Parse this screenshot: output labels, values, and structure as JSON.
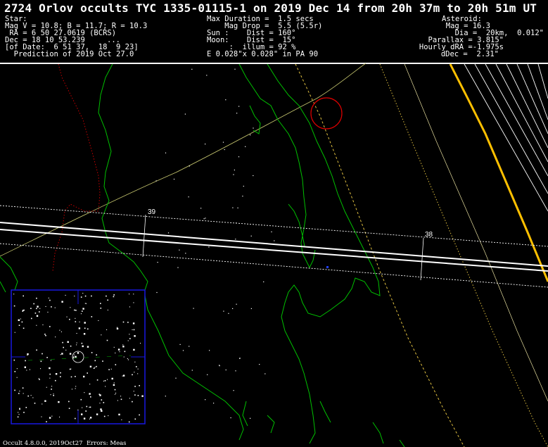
{
  "title": "2724 Orlov occults TYC 1335-01115-1 on 2019 Dec 14 from 20h 37m to 20h 51m UT",
  "star": {
    "heading": "Star:",
    "mags": "Mag V = 10.8; B = 11.7; R = 10.3",
    "ra": " RA = 6 50 27.0619 (BCRS)",
    "dec": "Dec = 18 10 53.239",
    "dec_extra": "...",
    "of_date": "[of Date:  6 51 37,  18  9 23]",
    "prediction": "  Prediction of 2019 Oct 27.0"
  },
  "event": {
    "max_duration": "Max Duration =  1.5 secs",
    "mag_drop": "    Mag Drop =  5.5 (5.5r)",
    "sun": "Sun :    Dist = 160°",
    "moon": "Moon:    Dist =  15°",
    "illum": "     :  illum = 92 %",
    "ellipse": "E 0.028\"x 0.028\" in PA 90"
  },
  "asteroid": {
    "heading": "Asteroid:",
    "mag": "Mag = 16.3",
    "dia": "Dia =  20km,  0.012\"",
    "parallax": "Parallax = 3.815\"",
    "hourly_dra": "Hourly dRA =-1.975s",
    "ddec": "dDec =  2.31\""
  },
  "map": {
    "time_labels": [
      "39",
      "38"
    ],
    "colors": {
      "coast": "#00c800",
      "border": "#c80000",
      "path": "#ffffff",
      "sigma": "#ffffff",
      "sun_limit": "#ffff80",
      "night_limit": "#ffc800",
      "inset_frame": "#1010e0",
      "marker": "#e00000"
    }
  },
  "footer": "Occult 4.8.0.0, 2019Oct27  Errors: Meas"
}
